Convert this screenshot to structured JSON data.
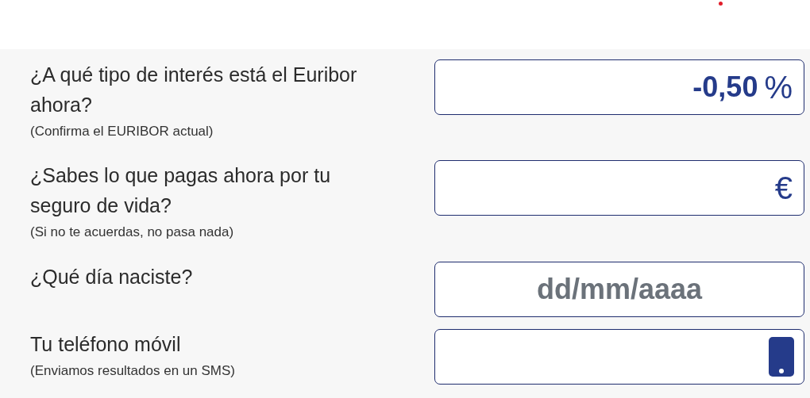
{
  "questions": [
    {
      "label": "¿A qué tipo de interés está el Euribor ahora?",
      "hint": "(Confirma el EURIBOR actual)",
      "field": {
        "kind": "number",
        "value": "-0,50",
        "unit": "%"
      }
    },
    {
      "label": "¿Sabes lo que pagas ahora por tu seguro de vida?",
      "hint": "(Si no te acuerdas, no pasa nada)",
      "field": {
        "kind": "number",
        "unit": "€"
      }
    },
    {
      "label": "¿Qué día naciste?",
      "field": {
        "kind": "date",
        "placeholder": "dd/mm/aaaa"
      }
    },
    {
      "label": "Tu teléfono móvil",
      "hint": "(Enviamos resultados en un SMS)",
      "field": {
        "kind": "phone"
      }
    }
  ]
}
